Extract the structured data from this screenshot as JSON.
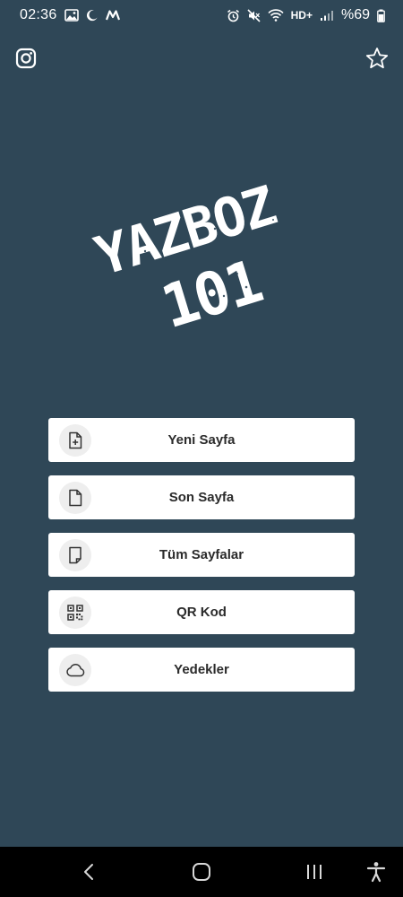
{
  "status_bar": {
    "time": "02:36",
    "network_type": "HD+",
    "battery": "%69"
  },
  "toolbar": {
    "left_icon": "instagram-icon",
    "right_icon": "star-icon"
  },
  "logo": {
    "line1": "YAZBOZ",
    "line2": "101"
  },
  "menu": {
    "items": [
      {
        "label": "Yeni Sayfa",
        "icon": "new-page-icon"
      },
      {
        "label": "Son Sayfa",
        "icon": "page-icon"
      },
      {
        "label": "Tüm Sayfalar",
        "icon": "pages-icon"
      },
      {
        "label": "QR Kod",
        "icon": "qr-code-icon"
      },
      {
        "label": "Yedekler",
        "icon": "cloud-icon"
      }
    ]
  },
  "colors": {
    "background": "#2f4757",
    "button": "#ffffff",
    "icon_circle": "#eeeeee",
    "text": "#2b2b2b"
  }
}
